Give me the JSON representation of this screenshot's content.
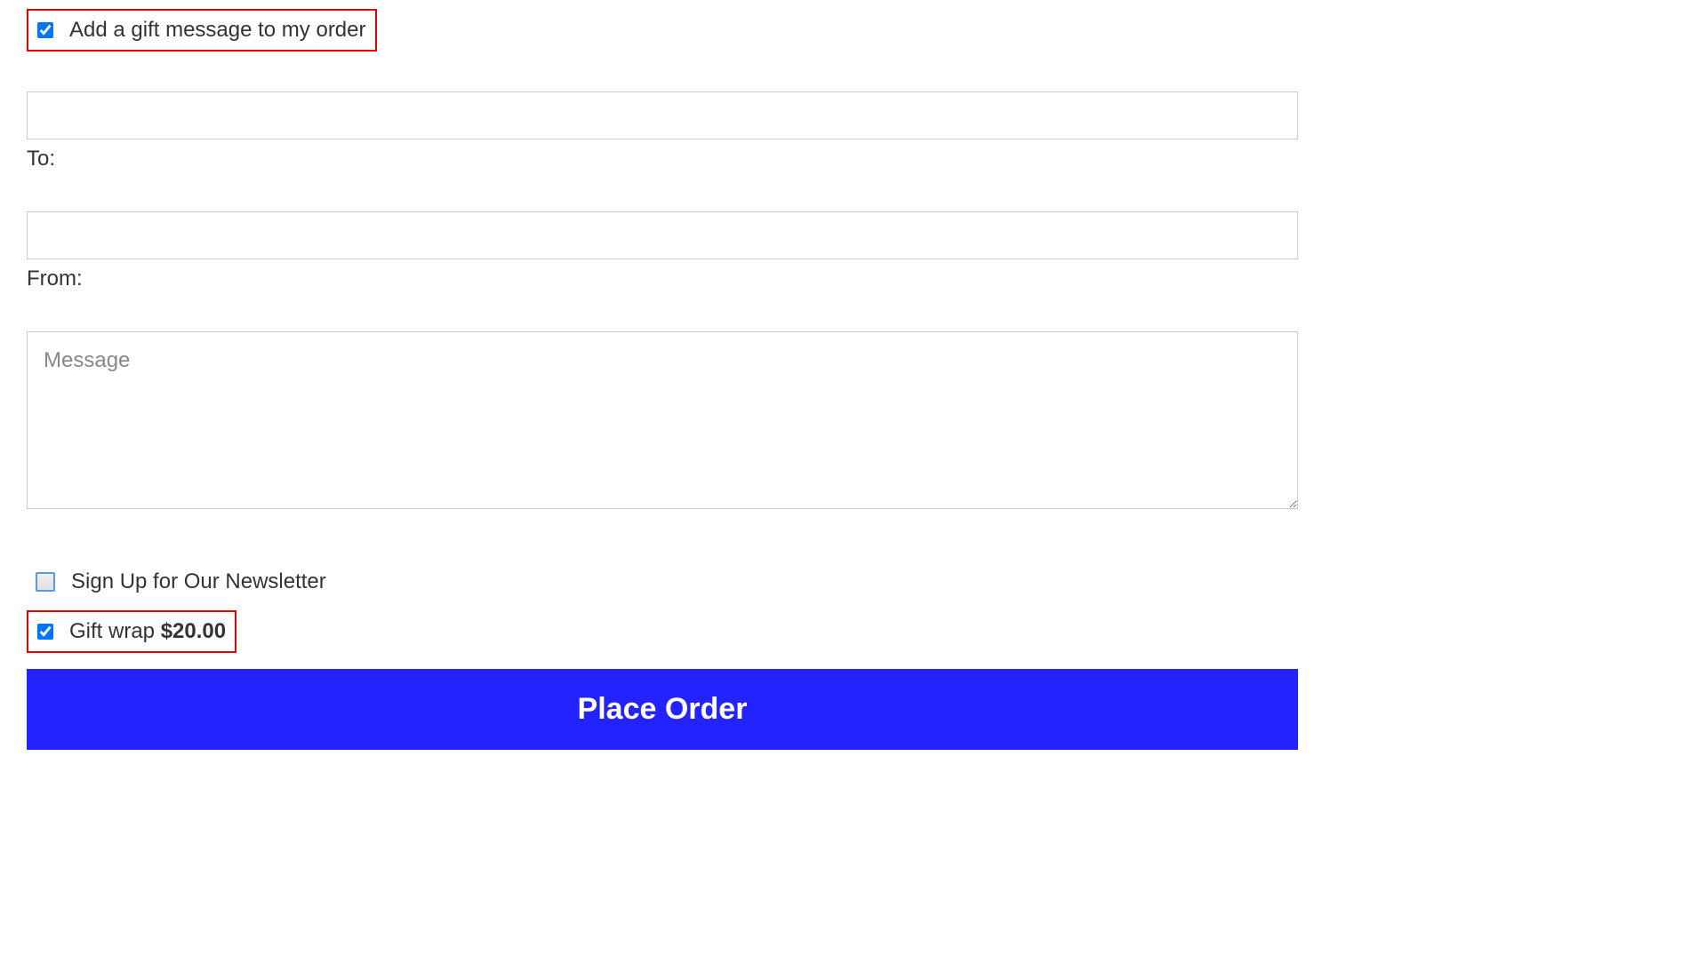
{
  "gift_message": {
    "checkbox_label": "Add a gift message to my order",
    "checked": true,
    "to_label": "To:",
    "to_value": "",
    "from_label": "From:",
    "from_value": "",
    "message_placeholder": "Message",
    "message_value": ""
  },
  "newsletter": {
    "label": "Sign Up for Our Newsletter",
    "checked": false
  },
  "gift_wrap": {
    "label": "Gift wrap ",
    "price": "$20.00",
    "checked": true
  },
  "place_order_button": "Place Order"
}
